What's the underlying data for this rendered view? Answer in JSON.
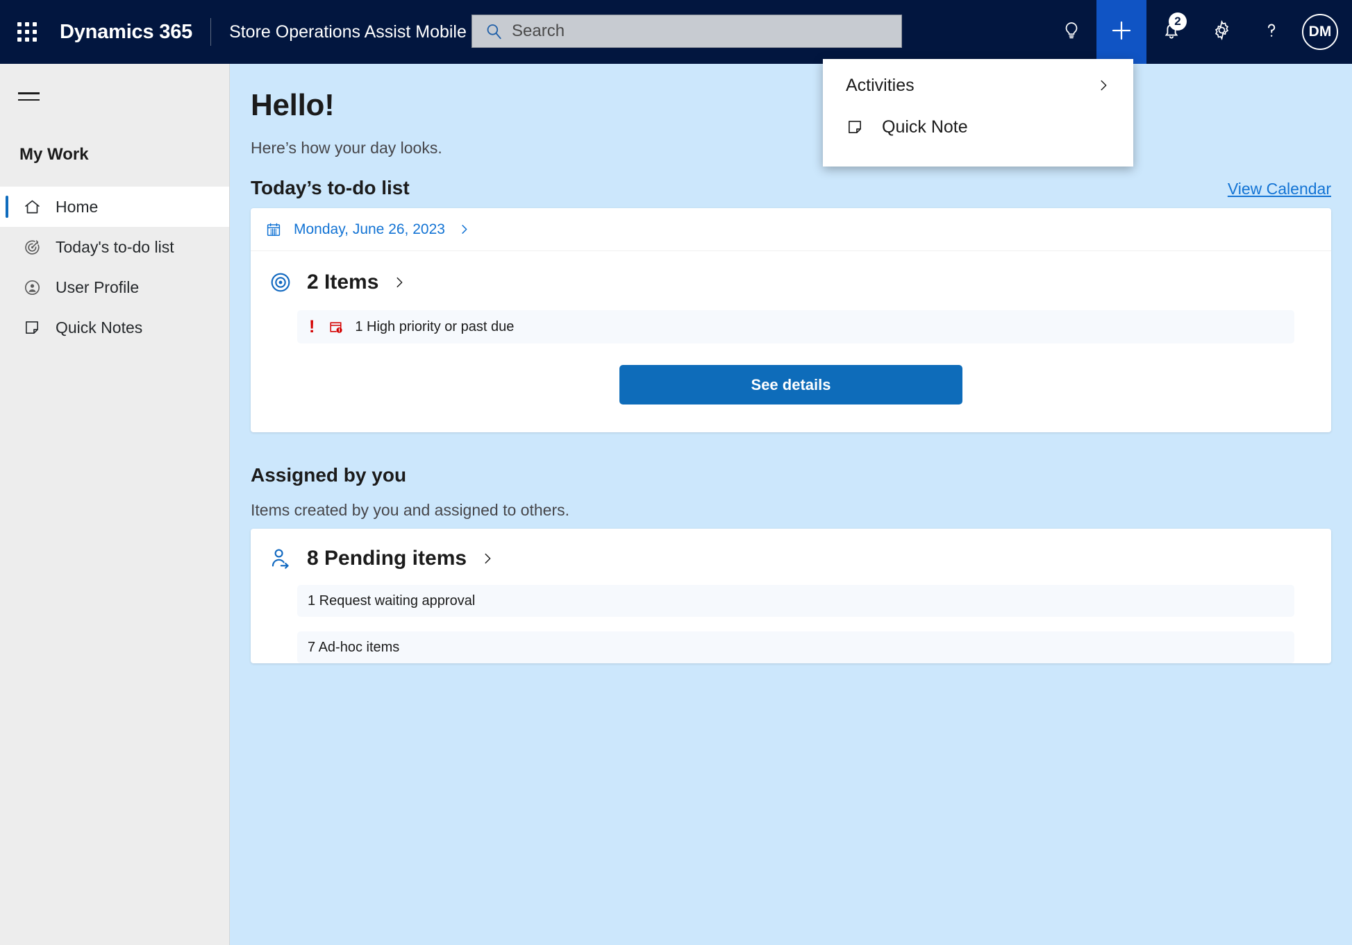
{
  "header": {
    "waffle_icon": "app-launcher-icon",
    "brand": "Dynamics 365",
    "app_name": "Store Operations Assist Mobile",
    "search": {
      "placeholder": "Search",
      "value": "",
      "icon": "search-icon"
    },
    "actions": [
      {
        "icon": "lightbulb-icon",
        "label": "Ideas"
      },
      {
        "icon": "plus-icon",
        "label": "Quick create"
      },
      {
        "icon": "bell-icon",
        "label": "Notifications",
        "badge": "2"
      },
      {
        "icon": "gear-icon",
        "label": "Settings"
      },
      {
        "icon": "question-icon",
        "label": "Help"
      }
    ],
    "avatar_initials": "DM"
  },
  "quick_create_menu": {
    "items": [
      {
        "label": "Activities",
        "icon": "chevron-right-icon",
        "has_submenu": true
      },
      {
        "label": "Quick Note",
        "icon": "note-icon",
        "has_submenu": false
      }
    ]
  },
  "sidebar": {
    "hamburger_icon": "hamburger-icon",
    "group_title": "My Work",
    "items": [
      {
        "label": "Home",
        "icon": "home-icon",
        "selected": true
      },
      {
        "label": "Today's to-do list",
        "icon": "target-arrow-icon",
        "selected": false
      },
      {
        "label": "User Profile",
        "icon": "person-circle-icon",
        "selected": false
      },
      {
        "label": "Quick Notes",
        "icon": "note-icon",
        "selected": false
      }
    ]
  },
  "main": {
    "greeting": "Hello!",
    "subgreeting": "Here’s how your day looks.",
    "todo": {
      "section_title": "Today’s to-do list",
      "view_calendar_label": "View Calendar",
      "date": "Monday, June 26, 2023",
      "date_icon": "calendar-icon",
      "items_count_label": "2 Items",
      "items_icon": "target-icon",
      "alert": {
        "icon": "calendar-alert-icon",
        "exclamation": "!",
        "text": "1 High priority or past due"
      },
      "details_button": "See details"
    },
    "assigned": {
      "section_title": "Assigned by you",
      "section_subtitle": "Items created by you and assigned to others.",
      "pending_count_label": "8 Pending items",
      "pending_icon": "person-arrow-icon",
      "rows": [
        "1 Request waiting approval",
        "7 Ad-hoc items"
      ]
    }
  },
  "colors": {
    "header_bg": "#02163f",
    "accent_blue": "#1054c4",
    "page_bg": "#cce7fc",
    "primary_button": "#0e6cba",
    "link_blue": "#1273d4",
    "alert_red": "#d40000",
    "sidebar_bg": "#ededed"
  }
}
